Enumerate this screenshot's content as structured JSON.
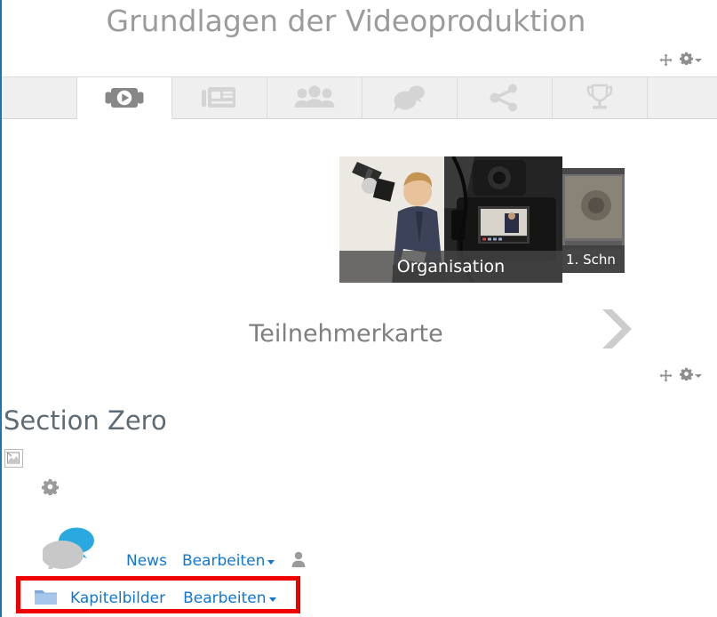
{
  "page": {
    "course_title": "Grundlagen der Videoproduktion",
    "accent_blue": "#1177d1",
    "highlight_color": "#ee0000",
    "title_color": "#9b9b9b"
  },
  "section_controls_top": {
    "move_icon": "move-icon",
    "gear_icon": "gear-icon"
  },
  "section_controls_middle": {
    "move_icon": "move-icon",
    "gear_icon": "gear-icon"
  },
  "tabs": [
    {
      "id": "videos",
      "icon": "video-camera-icon",
      "label": "Videos",
      "active": true
    },
    {
      "id": "news",
      "icon": "news-article-icon",
      "label": "News",
      "active": false
    },
    {
      "id": "participants",
      "icon": "people-group-icon",
      "label": "Teilnehmer",
      "active": false
    },
    {
      "id": "forum",
      "icon": "chat-bubbles-icon",
      "label": "Forum",
      "active": false
    },
    {
      "id": "share",
      "icon": "share-nodes-icon",
      "label": "Teilen",
      "active": false
    },
    {
      "id": "awards",
      "icon": "trophy-icon",
      "label": "Auszeichnungen",
      "active": false
    }
  ],
  "carousel": {
    "current_slide": {
      "caption": "Organisation",
      "image_alt": "Mann im Studio vor Videokamera"
    },
    "next_slide": {
      "caption": "1. Schn",
      "image_alt": "Schnittprogramm Screenshot"
    },
    "next_arrow_icon": "chevron-right-icon"
  },
  "activity_title": "Teilnehmerkarte",
  "section_zero": {
    "heading": "Section Zero",
    "broken_image_icon": "broken-image-icon",
    "gear_icon": "gear-icon"
  },
  "activities": [
    {
      "icon": "forum-chat-bubbles-icon",
      "name": "News",
      "edit_label": "Bearbeiten",
      "trailing_icon": "user-silhouette-icon",
      "highlighted": false
    },
    {
      "icon": "folder-icon",
      "name": "Kapitelbilder",
      "edit_label": "Bearbeiten",
      "trailing_icon": null,
      "highlighted": true
    }
  ]
}
